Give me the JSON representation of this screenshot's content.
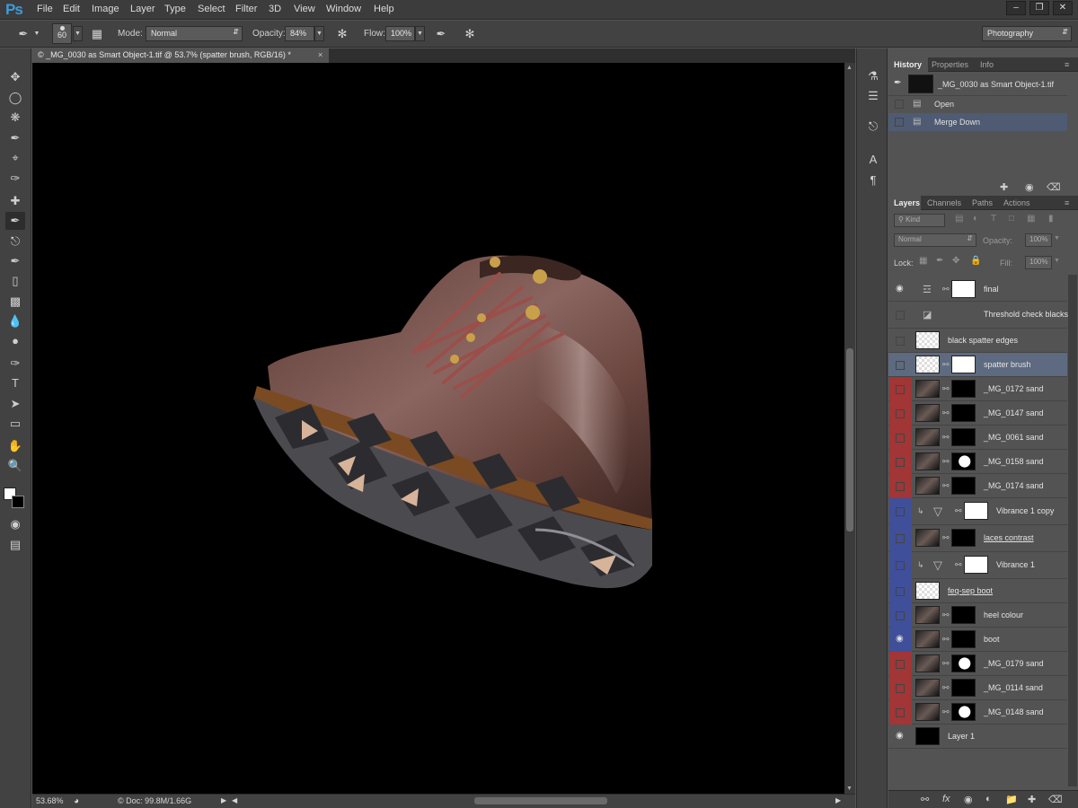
{
  "app": {
    "logo": "Ps"
  },
  "menu": [
    "File",
    "Edit",
    "Image",
    "Layer",
    "Type",
    "Select",
    "Filter",
    "3D",
    "View",
    "Window",
    "Help"
  ],
  "window_controls": [
    "–",
    "❐",
    "✕"
  ],
  "options": {
    "brush_size": "60",
    "mode_label": "Mode:",
    "mode_value": "Normal",
    "opacity_label": "Opacity:",
    "opacity_value": "84%",
    "flow_label": "Flow:",
    "flow_value": "100%",
    "workspace": "Photography"
  },
  "document": {
    "tab_title": "© _MG_0030 as Smart Object-1.tif @ 53.7% (spatter brush, RGB/16) *",
    "tab_close": "×"
  },
  "status": {
    "zoom": "53.68%",
    "doc": "Doc: 99.8M/1.66G"
  },
  "history_panel": {
    "tabs": [
      "History",
      "Properties",
      "Info"
    ],
    "snapshot": "_MG_0030 as Smart Object-1.tif",
    "items": [
      "Open",
      "Merge Down"
    ]
  },
  "layers_panel": {
    "tabs": [
      "Layers",
      "Channels",
      "Paths",
      "Actions"
    ],
    "filter_kind": "Kind",
    "blend_mode": "Normal",
    "opacity_label": "Opacity:",
    "opacity_value": "100%",
    "lock_label": "Lock:",
    "fill_label": "Fill:",
    "fill_value": "100%",
    "layers": [
      {
        "name": "final",
        "color": "none",
        "visible": true
      },
      {
        "name": "Threshold check blacks",
        "color": "none",
        "visible": false
      },
      {
        "name": "black spatter edges",
        "color": "none",
        "visible": false
      },
      {
        "name": "spatter brush",
        "color": "none",
        "visible": false,
        "selected": true
      },
      {
        "name": "_MG_0172 sand",
        "color": "#a23535",
        "visible": false
      },
      {
        "name": "_MG_0147 sand",
        "color": "#a23535",
        "visible": false
      },
      {
        "name": "_MG_0061 sand",
        "color": "#a23535",
        "visible": false
      },
      {
        "name": "_MG_0158 sand",
        "color": "#a23535",
        "visible": false
      },
      {
        "name": "_MG_0174 sand",
        "color": "#a23535",
        "visible": false
      },
      {
        "name": "Vibrance 1 copy",
        "color": "#3f4f9a",
        "visible": false
      },
      {
        "name": "laces contrast",
        "color": "#3f4f9a",
        "visible": false
      },
      {
        "name": "Vibrance 1",
        "color": "#3f4f9a",
        "visible": false
      },
      {
        "name": "feq-sep boot",
        "color": "#3f4f9a",
        "visible": false
      },
      {
        "name": "heel colour",
        "color": "#3f4f9a",
        "visible": false
      },
      {
        "name": "boot",
        "color": "#3f4f9a",
        "visible": true
      },
      {
        "name": "_MG_0179 sand",
        "color": "#a23535",
        "visible": false
      },
      {
        "name": "_MG_0114 sand",
        "color": "#a23535",
        "visible": false
      },
      {
        "name": "_MG_0148 sand",
        "color": "#a23535",
        "visible": false
      },
      {
        "name": "Layer 1",
        "color": "none",
        "visible": true
      }
    ]
  }
}
